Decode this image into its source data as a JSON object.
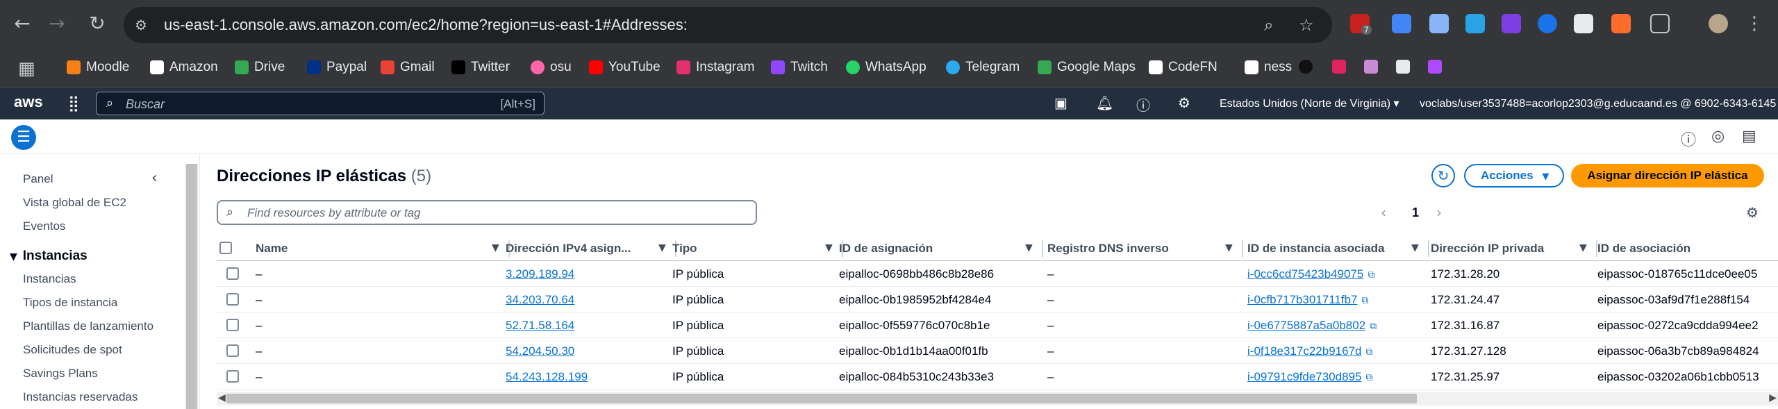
{
  "browser": {
    "url": "us-east-1.console.aws.amazon.com/ec2/home?region=us-east-1#Addresses:",
    "ext_badge": "7"
  },
  "bookmarks": [
    {
      "label": "Moodle",
      "color": "#f98012",
      "icon": "moodle-icon"
    },
    {
      "label": "Amazon",
      "color": "#ffffff",
      "icon": "amazon-icon"
    },
    {
      "label": "Drive",
      "color": "#34a853",
      "icon": "drive-icon"
    },
    {
      "label": "Paypal",
      "color": "#003087",
      "icon": "paypal-icon"
    },
    {
      "label": "Gmail",
      "color": "#ea4335",
      "icon": "gmail-icon"
    },
    {
      "label": "Twitter",
      "color": "#000000",
      "icon": "x-icon"
    },
    {
      "label": "osu",
      "color": "#ff66aa",
      "icon": "osu-icon"
    },
    {
      "label": "YouTube",
      "color": "#ff0000",
      "icon": "youtube-icon"
    },
    {
      "label": "Instagram",
      "color": "#e1306c",
      "icon": "instagram-icon"
    },
    {
      "label": "Twitch",
      "color": "#9146ff",
      "icon": "twitch-icon"
    },
    {
      "label": "WhatsApp",
      "color": "#25d366",
      "icon": "whatsapp-icon"
    },
    {
      "label": "Telegram",
      "color": "#2aabee",
      "icon": "telegram-icon"
    },
    {
      "label": "Google Maps",
      "color": "#34a853",
      "icon": "maps-icon"
    },
    {
      "label": "CodeFN",
      "color": "#ffffff",
      "icon": "codefn-icon"
    },
    {
      "label": "ness",
      "color": "#ffffff",
      "icon": "ness-icon"
    }
  ],
  "aws": {
    "logo": "aws",
    "search_placeholder": "Buscar",
    "search_shortcut": "[Alt+S]",
    "region": "Estados Unidos (Norte de Virginia)",
    "account": "voclabs/user3537488=acorlop2303@g.educaand.es @ 6902-6343-6145"
  },
  "sidebar": {
    "items_top": [
      "Panel",
      "Vista global de EC2",
      "Eventos"
    ],
    "section": "Instancias",
    "items": [
      "Instancias",
      "Tipos de instancia",
      "Plantillas de lanzamiento",
      "Solicitudes de spot",
      "Savings Plans",
      "Instancias reservadas"
    ]
  },
  "main": {
    "title": "Direcciones IP elásticas",
    "count": "(5)",
    "actions_label": "Acciones",
    "allocate_label": "Asignar dirección IP elástica",
    "filter_placeholder": "Find resources by attribute or tag",
    "page": "1"
  },
  "table": {
    "columns": [
      "Name",
      "Dirección IPv4 asign...",
      "Tipo",
      "ID de asignación",
      "Registro DNS inverso",
      "ID de instancia asociada",
      "Dirección IP privada",
      "ID de asociación"
    ],
    "rows": [
      {
        "name": "–",
        "ip": "3.209.189.94",
        "type": "IP pública",
        "alloc": "eipalloc-0698bb486c8b28e86",
        "dns": "–",
        "instance": "i-0cc6cd75423b49075",
        "private": "172.31.28.20",
        "assoc": "eipassoc-018765c11dce0ee05"
      },
      {
        "name": "–",
        "ip": "34.203.70.64",
        "type": "IP pública",
        "alloc": "eipalloc-0b1985952bf4284e4",
        "dns": "–",
        "instance": "i-0cfb717b301711fb7",
        "private": "172.31.24.47",
        "assoc": "eipassoc-03af9d7f1e288f154"
      },
      {
        "name": "–",
        "ip": "52.71.58.164",
        "type": "IP pública",
        "alloc": "eipalloc-0f559776c070c8b1e",
        "dns": "–",
        "instance": "i-0e6775887a5a0b802",
        "private": "172.31.16.87",
        "assoc": "eipassoc-0272ca9cdda994ee2"
      },
      {
        "name": "–",
        "ip": "54.204.50.30",
        "type": "IP pública",
        "alloc": "eipalloc-0b1d1b14aa00f01fb",
        "dns": "–",
        "instance": "i-0f18e317c22b9167d",
        "private": "172.31.27.128",
        "assoc": "eipassoc-06a3b7cb89a984824"
      },
      {
        "name": "–",
        "ip": "54.243.128.199",
        "type": "IP pública",
        "alloc": "eipalloc-084b5310c243b33e3",
        "dns": "–",
        "instance": "i-09791c9fde730d895",
        "private": "172.31.25.97",
        "assoc": "eipassoc-03202a06b1cbb0513"
      }
    ]
  }
}
